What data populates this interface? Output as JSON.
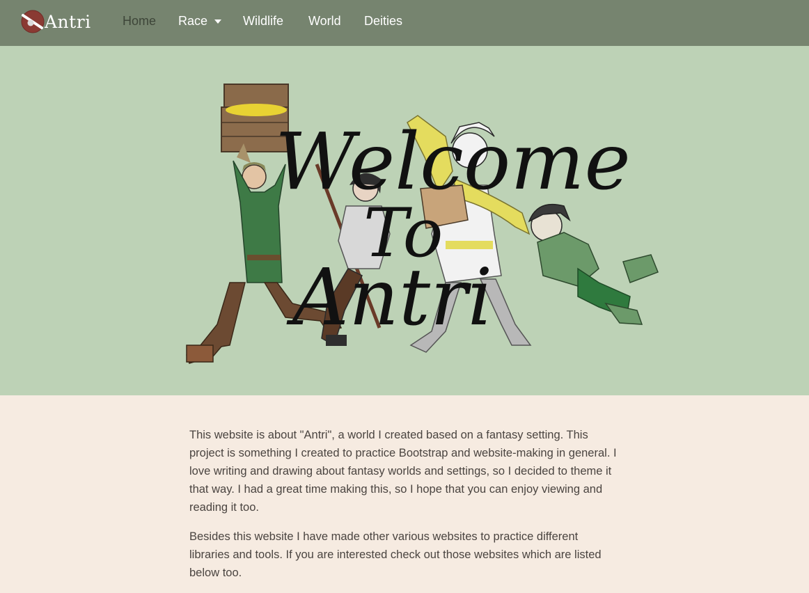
{
  "brand": {
    "name": "Antri",
    "logo_icon": "antri-logo-icon"
  },
  "nav": {
    "items": [
      {
        "label": "Home",
        "active": true
      },
      {
        "label": "Race",
        "dropdown": true
      },
      {
        "label": "Wildlife"
      },
      {
        "label": "World"
      },
      {
        "label": "Deities"
      }
    ]
  },
  "hero": {
    "title_lines": [
      "Welcome",
      "To",
      "Antri"
    ]
  },
  "content": {
    "paragraphs": [
      "This website is about \"Antri\", a world I created based on a fantasy setting. This project is something I created to practice Bootstrap and website-making in general. I love writing and drawing about fantasy worlds and settings, so I decided to theme it that way. I had a great time making this, so I hope that you can enjoy viewing and reading it too.",
      "Besides this website I have made other various websites to practice different libraries and tools. If you are interested check out those websites which are listed below too."
    ]
  },
  "colors": {
    "navbar": "#76846f",
    "hero_bg": "#bdd2b6",
    "page_bg": "#f6ebe1",
    "text": "#4a4440",
    "logo_red": "#8a3a33"
  }
}
